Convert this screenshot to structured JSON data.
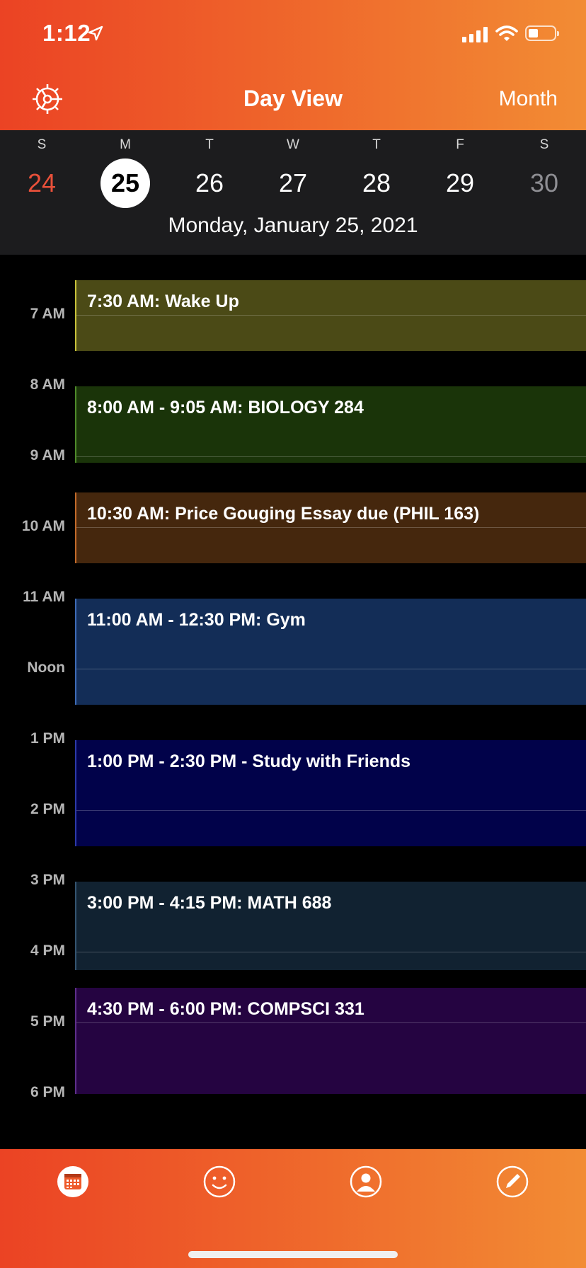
{
  "status": {
    "time": "1:12"
  },
  "nav": {
    "title": "Day View",
    "month_label": "Month"
  },
  "week": {
    "days": [
      {
        "letter": "S",
        "number": "24",
        "color": "#e8503a"
      },
      {
        "letter": "M",
        "number": "25",
        "selected": true
      },
      {
        "letter": "T",
        "number": "26"
      },
      {
        "letter": "W",
        "number": "27"
      },
      {
        "letter": "T",
        "number": "28"
      },
      {
        "letter": "F",
        "number": "29"
      },
      {
        "letter": "S",
        "number": "30",
        "color": "#8e8e93"
      }
    ],
    "selected_date": "Monday, January 25, 2021"
  },
  "hours": [
    "7 AM",
    "8 AM",
    "9 AM",
    "10 AM",
    "11 AM",
    "Noon",
    "1 PM",
    "2 PM",
    "3 PM",
    "4 PM",
    "5 PM",
    "6 PM"
  ],
  "events": [
    {
      "label": "7:30 AM: Wake Up",
      "color": "#4b4a16",
      "border": "#c8c23a"
    },
    {
      "label": "8:00 AM - 9:05 AM: BIOLOGY 284",
      "color": "#1a3409",
      "border": "#4f8a2a"
    },
    {
      "label": "10:30 AM: Price Gouging Essay due (PHIL 163)",
      "color": "#45270d",
      "border": "#c26a2a"
    },
    {
      "label": "11:00 AM - 12:30 PM: Gym",
      "color": "#132d57",
      "border": "#3e6bb5"
    },
    {
      "label": "1:00 PM - 2:30 PM - Study with Friends",
      "color": "#01024a",
      "border": "#2d3aa8"
    },
    {
      "label": "3:00 PM - 4:15 PM: MATH 688",
      "color": "#112231",
      "border": "#34546f"
    },
    {
      "label": "4:30 PM - 6:00 PM: COMPSCI 331",
      "color": "#250441",
      "border": "#5e2f8a"
    }
  ],
  "tabs": [
    {
      "icon": "calendar-icon"
    },
    {
      "icon": "smiley-icon"
    },
    {
      "icon": "profile-icon"
    },
    {
      "icon": "compose-icon"
    }
  ],
  "colors": {
    "accent_start": "#eb4324",
    "accent_end": "#f28c34"
  }
}
